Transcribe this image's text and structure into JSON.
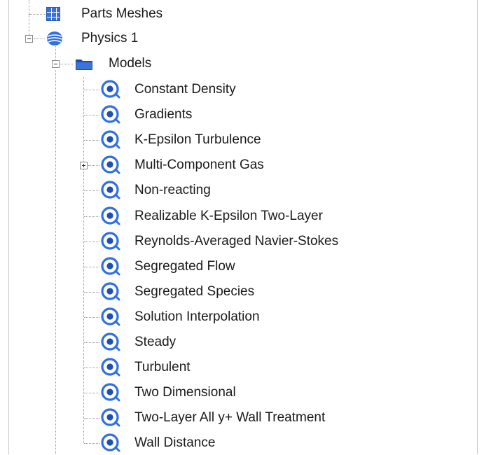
{
  "tree": {
    "parts_meshes": {
      "label": "Parts Meshes",
      "icon": "mesh-grid-icon"
    },
    "physics": {
      "label": "Physics 1",
      "icon": "physics-sphere-icon",
      "expanded": true
    },
    "models": {
      "label": "Models",
      "icon": "folder-icon",
      "expanded": true
    },
    "model_items": [
      {
        "label": "Constant Density",
        "icon": "model-icon",
        "expandable": false
      },
      {
        "label": "Gradients",
        "icon": "model-icon",
        "expandable": false
      },
      {
        "label": "K-Epsilon Turbulence",
        "icon": "model-icon",
        "expandable": false
      },
      {
        "label": "Multi-Component Gas",
        "icon": "model-icon",
        "expandable": true
      },
      {
        "label": "Non-reacting",
        "icon": "model-icon",
        "expandable": false
      },
      {
        "label": "Realizable K-Epsilon Two-Layer",
        "icon": "model-icon",
        "expandable": false
      },
      {
        "label": "Reynolds-Averaged Navier-Stokes",
        "icon": "model-icon",
        "expandable": false
      },
      {
        "label": "Segregated Flow",
        "icon": "model-icon",
        "expandable": false
      },
      {
        "label": "Segregated Species",
        "icon": "model-icon",
        "expandable": false
      },
      {
        "label": "Solution Interpolation",
        "icon": "model-icon",
        "expandable": false
      },
      {
        "label": "Steady",
        "icon": "model-icon",
        "expandable": false
      },
      {
        "label": "Turbulent",
        "icon": "model-icon",
        "expandable": false
      },
      {
        "label": "Two Dimensional",
        "icon": "model-icon",
        "expandable": false
      },
      {
        "label": "Two-Layer All y+ Wall Treatment",
        "icon": "model-icon",
        "expandable": false
      },
      {
        "label": "Wall Distance",
        "icon": "model-icon",
        "expandable": false
      }
    ]
  }
}
